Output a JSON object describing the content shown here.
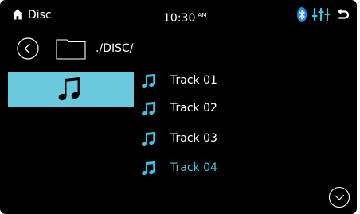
{
  "status_bar": {
    "source_label": "Disc",
    "time": "10:30",
    "ampm": "AM"
  },
  "path_bar": {
    "path": "./DISC/"
  },
  "category_tab": {
    "icon": "music-note-icon",
    "selected": true
  },
  "tracks": [
    {
      "name": "Track 01",
      "state": "normal"
    },
    {
      "name": "Track 02",
      "state": "normal"
    },
    {
      "name": "Track 03",
      "state": "normal"
    },
    {
      "name": "Track 04",
      "state": "active"
    }
  ],
  "colors": {
    "background": "#000000",
    "accent": "#41c3dc",
    "tab_fill": "#6bc9dd",
    "text": "#ffffff",
    "bluetooth": "#1a8cf2",
    "eq": "#41c3dc"
  }
}
